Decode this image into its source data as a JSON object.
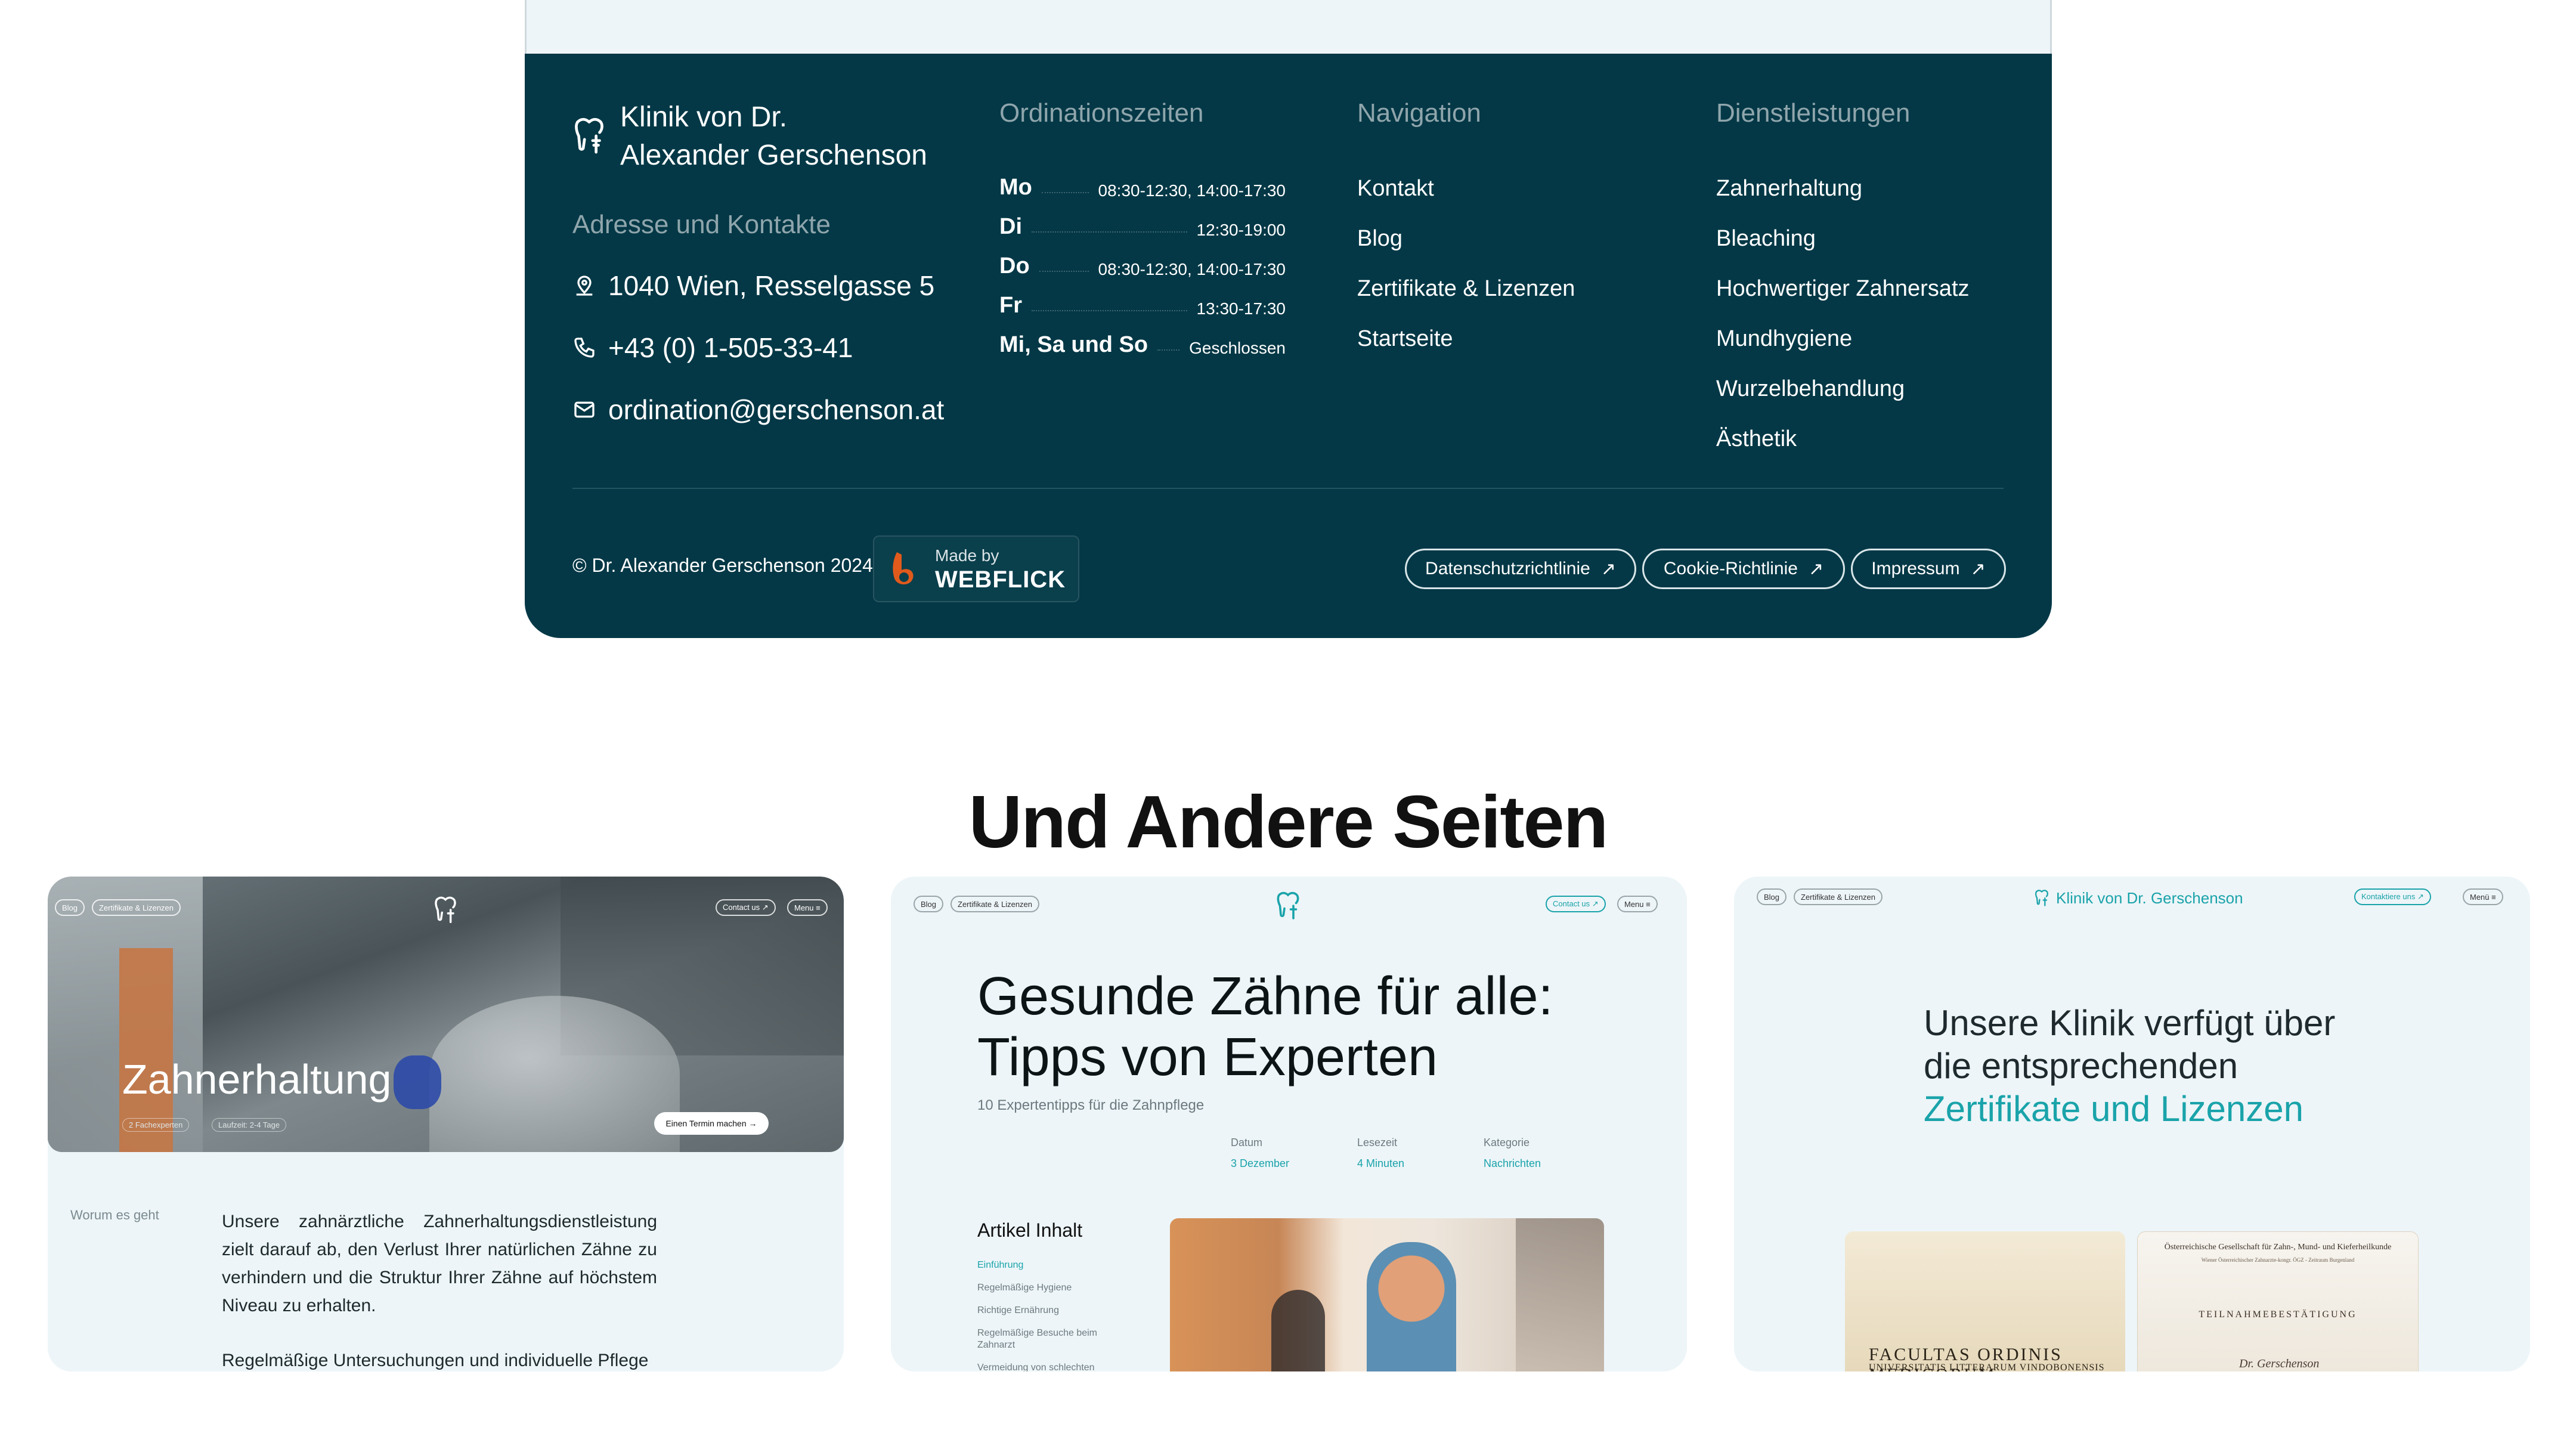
{
  "footer": {
    "brand": {
      "line1": "Klinik von Dr.",
      "line2": "Alexander Gerschenson"
    },
    "address_title": "Adresse und Kontakte",
    "address": "1040 Wien, Resselgasse 5",
    "phone": "+43 (0) 1-505-33-41",
    "email": "ordination@gerschenson.at",
    "hours_title": "Ordinationszeiten",
    "hours": [
      {
        "day": "Mo",
        "time": "08:30-12:30, 14:00-17:30"
      },
      {
        "day": "Di",
        "time": "12:30-19:00"
      },
      {
        "day": "Do",
        "time": "08:30-12:30, 14:00-17:30"
      },
      {
        "day": "Fr",
        "time": "13:30-17:30"
      },
      {
        "day": "Mi, Sa und So",
        "time": "Geschlossen"
      }
    ],
    "nav_title": "Navigation",
    "nav": [
      "Kontakt",
      "Blog",
      "Zertifikate & Lizenzen",
      "Startseite"
    ],
    "services_title": "Dienstleistungen",
    "services": [
      "Zahnerhaltung",
      "Bleaching",
      "Hochwertiger Zahnersatz",
      "Mundhygiene",
      "Wurzelbehandlung",
      "Ästhetik"
    ],
    "copyright": "© Dr. Alexander Gerschenson 2024",
    "made_by": "Made by",
    "made_by_brand": "WEBFLICK",
    "legal": [
      "Datenschutzrichtlinie",
      "Cookie-Richtlinie",
      "Impressum"
    ],
    "arrow": "↗"
  },
  "section_title": "Und Andere Seiten",
  "card1": {
    "nav_left": [
      "Blog",
      "Zertifikate & Lizenzen"
    ],
    "nav_right": [
      "Contact us ↗",
      "Menu ≡"
    ],
    "title": "Zahnerhaltung",
    "tag1": "2 Fachexperten",
    "tag2": "Laufzeit: 2-4 Tage",
    "cta": "Einen Termin machen →",
    "side_label": "Worum es geht",
    "text": "Unsere zahnärztliche Zahnerhaltungsdienstleistung zielt darauf ab, den Verlust Ihrer natürlichen Zähne zu verhindern und die Struktur Ihrer Zähne auf höchstem Niveau zu erhalten.",
    "text2": "Regelmäßige Untersuchungen und individuelle Pflege"
  },
  "card2": {
    "nav_left": [
      "Blog",
      "Zertifikate & Lizenzen"
    ],
    "nav_right": [
      "Contact us ↗",
      "Menu ≡"
    ],
    "title_line1": "Gesunde Zähne für alle:",
    "title_line2": "Tipps von Experten",
    "subtitle": "10 Expertentipps für die Zahnpflege",
    "meta": [
      {
        "k": "Datum",
        "v": "3 Dezember"
      },
      {
        "k": "Lesezeit",
        "v": "4 Minuten"
      },
      {
        "k": "Kategorie",
        "v": "Nachrichten"
      }
    ],
    "toc_title": "Artikel Inhalt",
    "toc": [
      "Einführung",
      "Regelmäßige Hygiene",
      "Richtige Ernährung",
      "Regelmäßige Besuche beim Zahnarzt",
      "Vermeidung von schlechten"
    ]
  },
  "card3": {
    "nav_left": [
      "Blog",
      "Zertifikate & Lizenzen"
    ],
    "brand": "Klinik von Dr. Gerschenson",
    "nav_right": [
      "Kontaktiere uns ↗",
      "Menü ≡"
    ],
    "title_line1": "Unsere Klinik verfügt über",
    "title_line2": "die entsprechenden",
    "title_highlight": "Zertifikate und Lizenzen",
    "cert1_line1": "FACULTAS ORDINIS MEDICORUM",
    "cert1_line2": "UNIVERSITATIS LITTERARUM VINDOBONENSIS",
    "cert2_header": "Österreichische Gesellschaft für Zahn-, Mund- und Kieferheilkunde",
    "cert2_sub": "Wiener Österreichischer Zahnarzte-kongr. ÖGZ - Zeitraum Burgenland",
    "cert2_title": "TEILNAHMEBESTÄTIGUNG",
    "cert2_sig": "Dr. Gerschenson"
  },
  "colors": {
    "footer_bg": "#043846",
    "accent": "#1aa3aa",
    "muted": "#8fa5ac"
  }
}
